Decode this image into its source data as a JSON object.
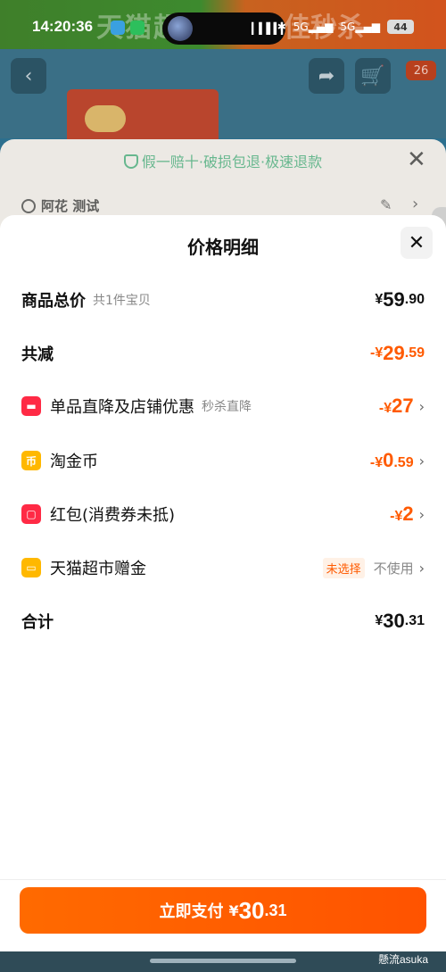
{
  "status_bar": {
    "time": "14:20:36",
    "network": "5G",
    "network2": "5G",
    "battery": "44"
  },
  "background": {
    "banner_left": "天猫超",
    "banner_right": "佳秒杀",
    "cart_badge": "26"
  },
  "under_sheet": {
    "guarantee": "假一赔十·破损包退·极速退款",
    "address": "阿花 测试"
  },
  "sheet": {
    "title": "价格明细",
    "rows": [
      {
        "label": "商品总价",
        "sub": "共1件宝贝",
        "currency": "¥",
        "int": "59",
        "dec": ".90"
      },
      {
        "label": "共减",
        "currency": "-¥",
        "int": "29",
        "dec": ".59"
      },
      {
        "label": "单品直降及店铺优惠",
        "sub": "秒杀直降",
        "currency": "-¥",
        "int": "27",
        "dec": "",
        "icon": "shop-discount-icon",
        "icon_color": "#ff2a45"
      },
      {
        "label": "淘金币",
        "currency": "-¥",
        "int": "0",
        "dec": ".59",
        "icon": "taojinbi-icon",
        "icon_glyph": "币",
        "icon_color": "#ffb800"
      },
      {
        "label": "红包(消费券未抵)",
        "currency": "-¥",
        "int": "2",
        "dec": "",
        "icon": "red-packet-icon",
        "icon_color": "#ff2a45"
      },
      {
        "label": "天猫超市赠金",
        "tag": "未选择",
        "status": "不使用",
        "icon": "tmall-gift-icon",
        "icon_color": "#ffb800"
      },
      {
        "label": "合计",
        "currency": "¥",
        "int": "30",
        "dec": ".31"
      }
    ]
  },
  "footer": {
    "pay_label": "立即支付",
    "currency": "¥",
    "int": "30",
    "dec": ".31",
    "watermark": "懸流asuka"
  },
  "colors": {
    "accent": "#ff5a00",
    "red_icon": "#ff2a45",
    "yellow_icon": "#ffb800",
    "guarantee_green": "#2fa36b"
  }
}
